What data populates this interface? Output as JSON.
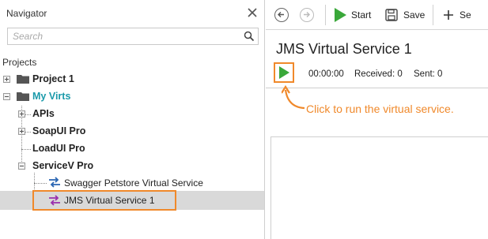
{
  "navigator": {
    "title": "Navigator",
    "search_placeholder": "Search",
    "projects_label": "Projects",
    "tree": {
      "project1": "Project 1",
      "myvirts": "My Virts",
      "apis": "APIs",
      "soapui": "SoapUI Pro",
      "loadui": "LoadUI Pro",
      "servicev": "ServiceV Pro",
      "swagger": "Swagger Petstore Virtual Service",
      "jms": "JMS Virtual Service 1"
    }
  },
  "toolbar": {
    "start_label": "Start",
    "save_label": "Save",
    "new_label": "Se"
  },
  "service": {
    "title": "JMS Virtual Service 1",
    "timer": "00:00:00",
    "received": "Received: 0",
    "sent": "Sent: 0"
  },
  "callout": {
    "text": "Click to run the virtual service."
  },
  "colors": {
    "accent_orange": "#f0892b",
    "teal_text": "#1b9aaa",
    "play_green": "#3aa83a",
    "selection_bg": "#d9d9d9"
  }
}
